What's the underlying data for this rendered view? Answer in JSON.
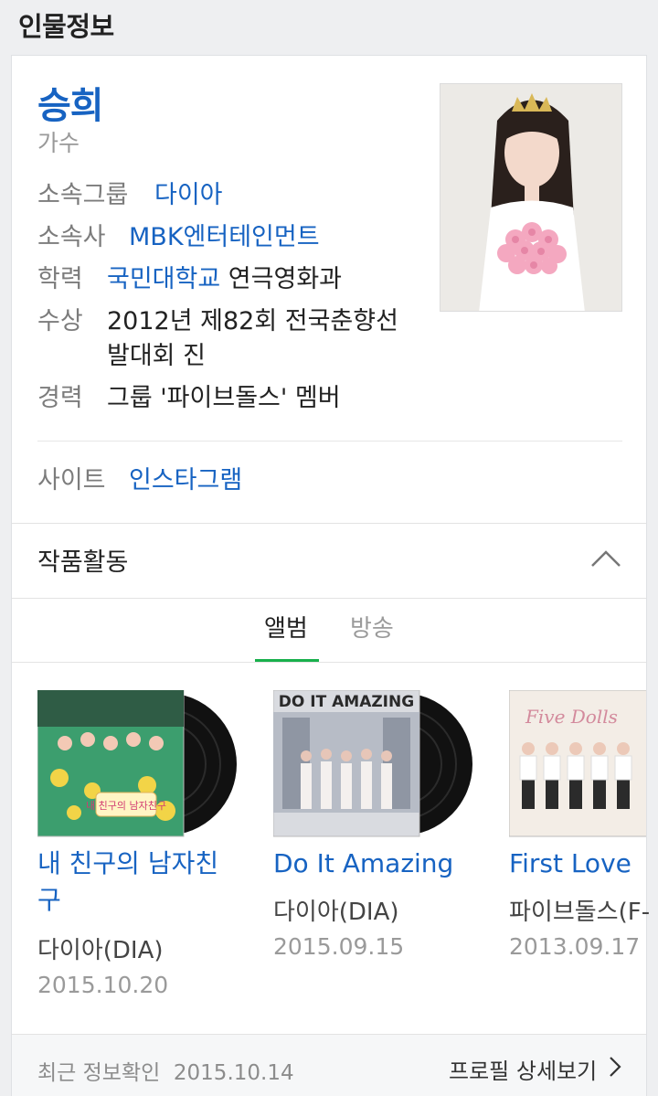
{
  "section": {
    "title": "인물정보"
  },
  "profile": {
    "name": "승희",
    "role": "가수",
    "info": [
      {
        "label": "소속그룹",
        "value": "다이아"
      },
      {
        "label": "소속사",
        "value": "MBK엔터테인먼트"
      },
      {
        "label": "학력",
        "link": "국민대학교",
        "value": "연극영화과"
      },
      {
        "label": "수상",
        "value": "2012년 제82회 전국춘향선",
        "value2": "발대회 진"
      },
      {
        "label": "경력",
        "value": "그룹 '파이브돌스' 멤버"
      }
    ],
    "site": {
      "label": "사이트",
      "value": "인스타그램"
    }
  },
  "works": {
    "title": "작품활동",
    "tabs": [
      {
        "label": "앨범"
      },
      {
        "label": "방송"
      }
    ],
    "albums": [
      {
        "title_line1": "내 친구의 남자친",
        "title_line2": "구",
        "artist": "다이아(DIA)",
        "date": "2015.10.20",
        "cover_text": "내 친구의 남자친구"
      },
      {
        "title_line1": "Do It Amazing",
        "artist": "다이아(DIA)",
        "date": "2015.09.15",
        "cover_text": "DO IT AMAZING"
      },
      {
        "title_line1": "First Love",
        "artist": "파이브돌스(F-",
        "date": "2013.09.17",
        "cover_text": "Five Dolls"
      }
    ]
  },
  "footer": {
    "updated_label": "최근 정보확인",
    "updated_date": "2015.10.14",
    "detail_link": "프로필 상세보기"
  },
  "colors": {
    "link": "#1763c2",
    "active_tab": "#18b04c",
    "background": "#eeeff1"
  }
}
